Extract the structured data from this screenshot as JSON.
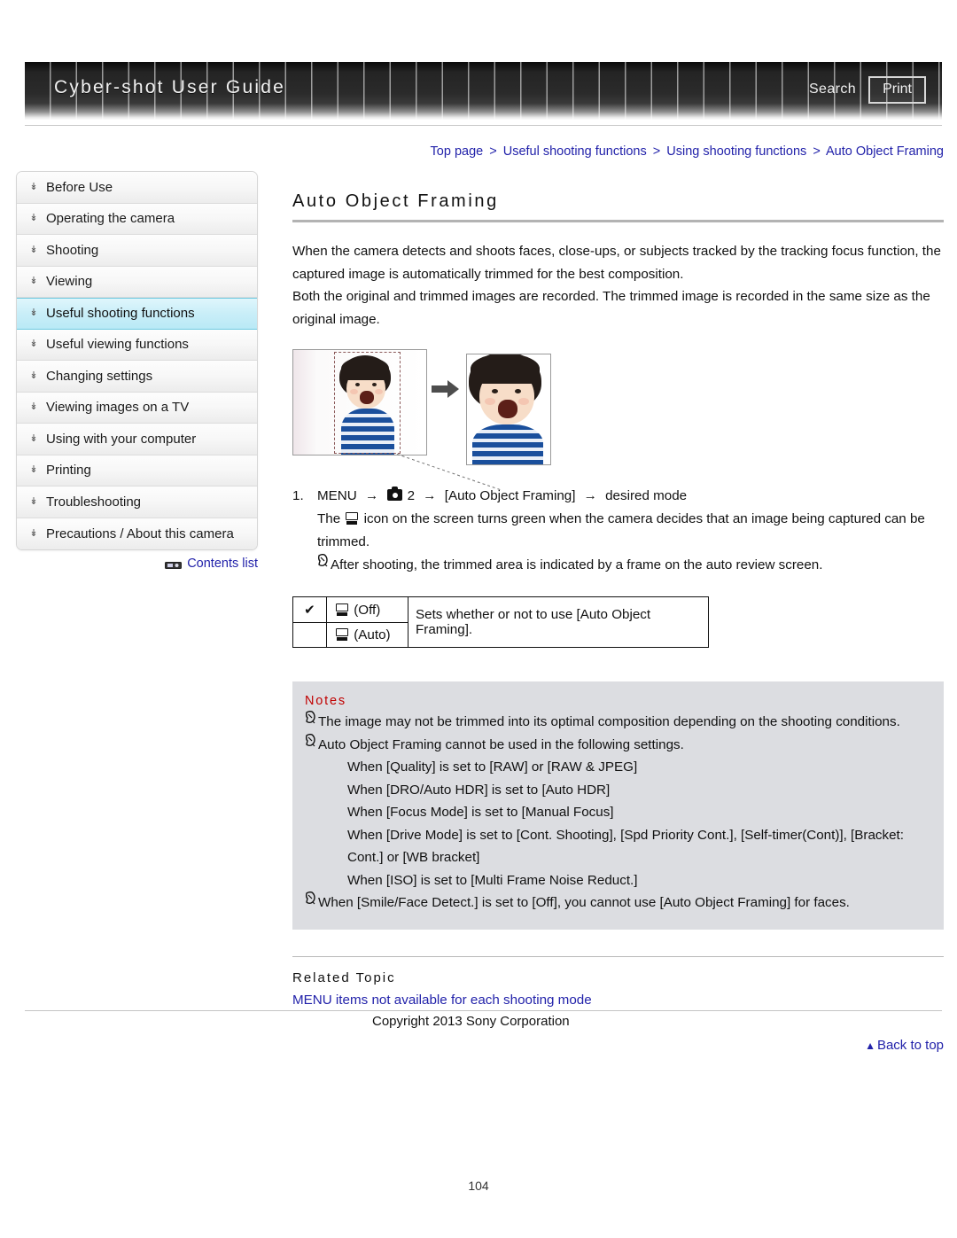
{
  "header": {
    "title": "Cyber-shot User Guide",
    "search_label": "Search",
    "print_label": "Print"
  },
  "breadcrumb": {
    "items": [
      "Top page",
      "Useful shooting functions",
      "Using shooting functions",
      "Auto Object Framing"
    ],
    "separator": ">"
  },
  "sidebar": {
    "items": [
      {
        "label": "Before Use",
        "active": false
      },
      {
        "label": "Operating the camera",
        "active": false
      },
      {
        "label": "Shooting",
        "active": false
      },
      {
        "label": "Viewing",
        "active": false
      },
      {
        "label": "Useful shooting functions",
        "active": true
      },
      {
        "label": "Useful viewing functions",
        "active": false
      },
      {
        "label": "Changing settings",
        "active": false
      },
      {
        "label": "Viewing images on a TV",
        "active": false
      },
      {
        "label": "Using with your computer",
        "active": false
      },
      {
        "label": "Printing",
        "active": false
      },
      {
        "label": "Troubleshooting",
        "active": false
      },
      {
        "label": "Precautions / About this camera",
        "active": false
      }
    ],
    "bullet_icon": "small-arrow-icon",
    "contents_list_label": "Contents list",
    "contents_list_icon": "camera-icon"
  },
  "main": {
    "page_title": "Auto Object Framing",
    "intro_paragraphs": [
      "When the camera detects and shoots faces, close-ups, or subjects tracked by the tracking focus function, the captured image is automatically trimmed for the best composition.",
      "Both the original and trimmed images are recorded. The trimmed image is recorded in the same size as the original image."
    ],
    "illustration": {
      "name": "auto-object-framing-illustration",
      "arrow_glyph": "➡"
    },
    "steps": [
      {
        "number": "1.",
        "prefix": "MENU",
        "arrow": "→",
        "camera_icon": "camera-icon",
        "menu_tab": "2",
        "menu_item": "[Auto Object Framing]",
        "suffix": "desired mode"
      }
    ],
    "step_notes": [
      {
        "icon": "auto-framing-icon",
        "before": "The",
        "after": "icon on the screen turns green when the camera decides that an image being captured can be trimmed."
      },
      {
        "icon": "note-pointer-icon",
        "text": "After shooting, the trimmed area is indicated by a frame on the auto review screen."
      }
    ],
    "options_table": {
      "rows": [
        {
          "checked": true,
          "check_glyph": "✔",
          "icon": "framing-off-icon",
          "label": "(Off)"
        },
        {
          "checked": false,
          "check_glyph": "",
          "icon": "framing-auto-icon",
          "label": "(Auto)"
        }
      ],
      "description": "Sets whether or not to use [Auto Object Framing]."
    },
    "notes": {
      "title": "Notes",
      "bullet_icon": "note-pointer-icon",
      "items": [
        {
          "text": "The image may not be trimmed into its optimal composition depending on the shooting conditions.",
          "subitems": []
        },
        {
          "text": "Auto Object Framing cannot be used in the following settings.",
          "subitems": [
            "When [Quality] is set to [RAW] or [RAW & JPEG]",
            "When [DRO/Auto HDR] is set to [Auto HDR]",
            "When [Focus Mode] is set to [Manual Focus]",
            "When [Drive Mode] is set to [Cont. Shooting], [Spd Priority Cont.], [Self-timer(Cont)], [Bracket: Cont.] or [WB bracket]",
            "When [ISO] is set to [Multi Frame Noise Reduct.]"
          ]
        },
        {
          "text": "When [Smile/Face Detect.] is set to [Off], you cannot use [Auto Object Framing] for faces.",
          "subitems": []
        }
      ]
    },
    "related": {
      "title": "Related Topic",
      "links": [
        "MENU items not available for each shooting mode"
      ]
    },
    "back_to_top": {
      "label": "Back to top",
      "icon": "triangle-up-icon"
    }
  },
  "footer": {
    "copyright": "Copyright 2013 Sony Corporation",
    "page_number": "104"
  },
  "colors": {
    "link": "#2222aa",
    "notes_title": "#c00000",
    "notes_bg": "#dcdde1",
    "active_nav": "#c9eef8"
  }
}
